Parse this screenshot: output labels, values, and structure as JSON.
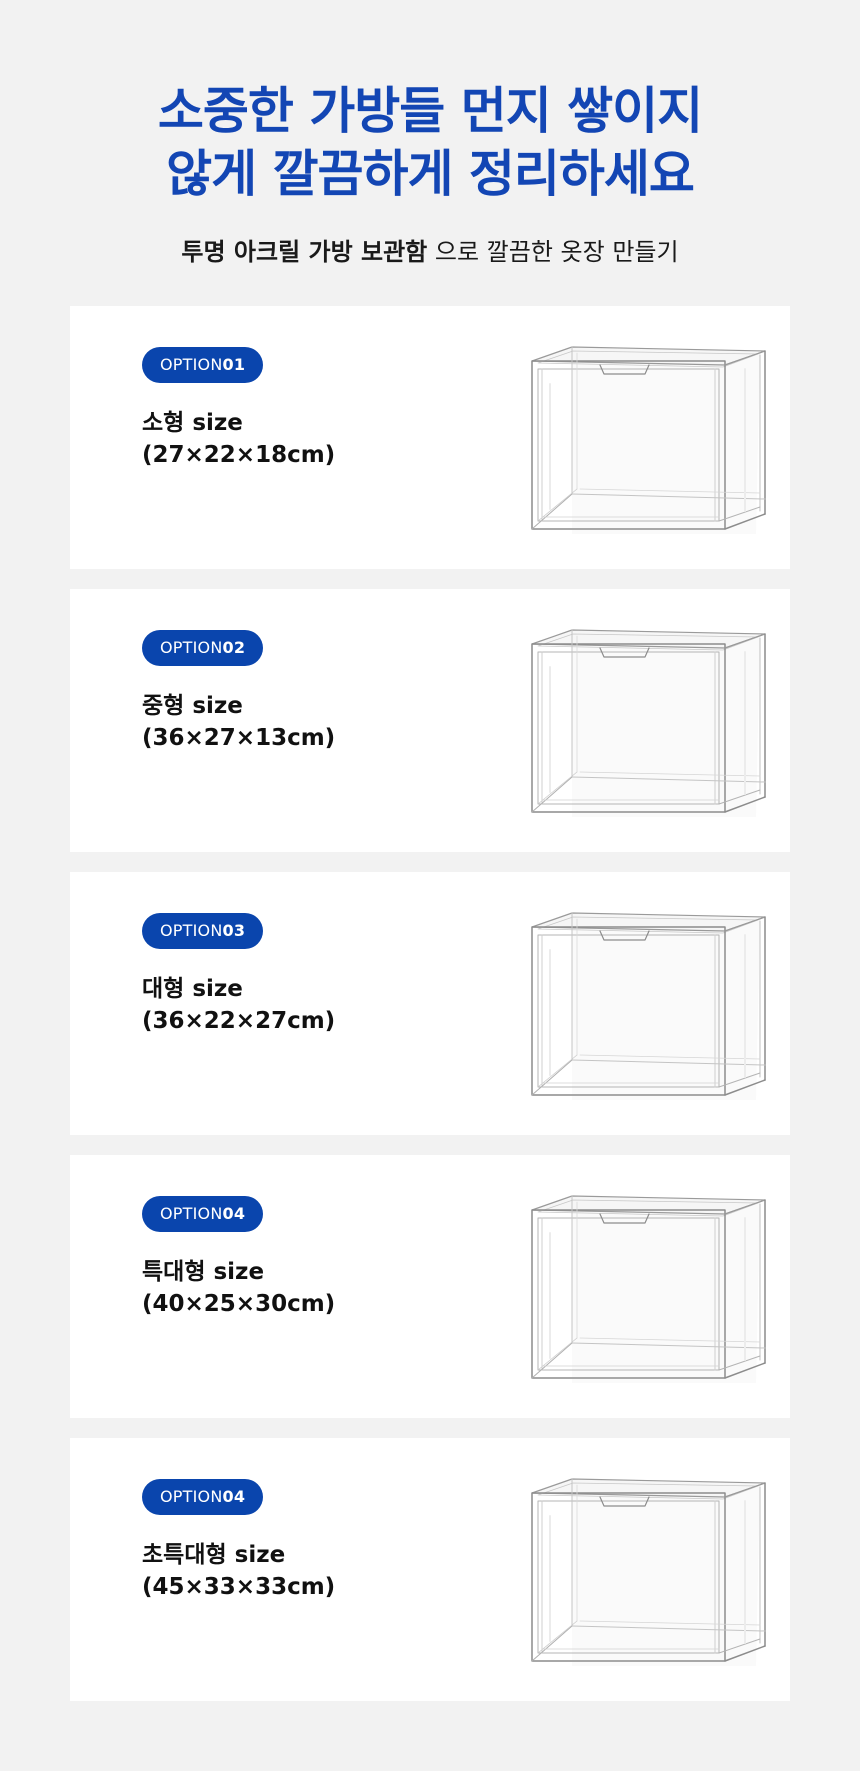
{
  "hero": {
    "title_line1": "소중한 가방들 먼지 쌓이지",
    "title_line2": "않게 깔끔하게 정리하세요",
    "subtitle_bold": "투명 아크릴 가방 보관함",
    "subtitle_rest": " 으로 깔끔한 옷장 만들기",
    "accent_color": "#1346b4"
  },
  "options": [
    {
      "badge_prefix": "OPTION",
      "badge_number": "01",
      "size_name": "소형 size",
      "dimensions": "(27×22×18cm)"
    },
    {
      "badge_prefix": "OPTION",
      "badge_number": "02",
      "size_name": "중형 size",
      "dimensions": "(36×27×13cm)"
    },
    {
      "badge_prefix": "OPTION",
      "badge_number": "03",
      "size_name": "대형 size",
      "dimensions": "(36×22×27cm)"
    },
    {
      "badge_prefix": "OPTION",
      "badge_number": "04",
      "size_name": "특대형 size",
      "dimensions": "(40×25×30cm)"
    },
    {
      "badge_prefix": "OPTION",
      "badge_number": "04",
      "size_name": "초특대형 size",
      "dimensions": "(45×33×33cm)"
    }
  ],
  "product_image_icon": "clear-acrylic-box-icon"
}
